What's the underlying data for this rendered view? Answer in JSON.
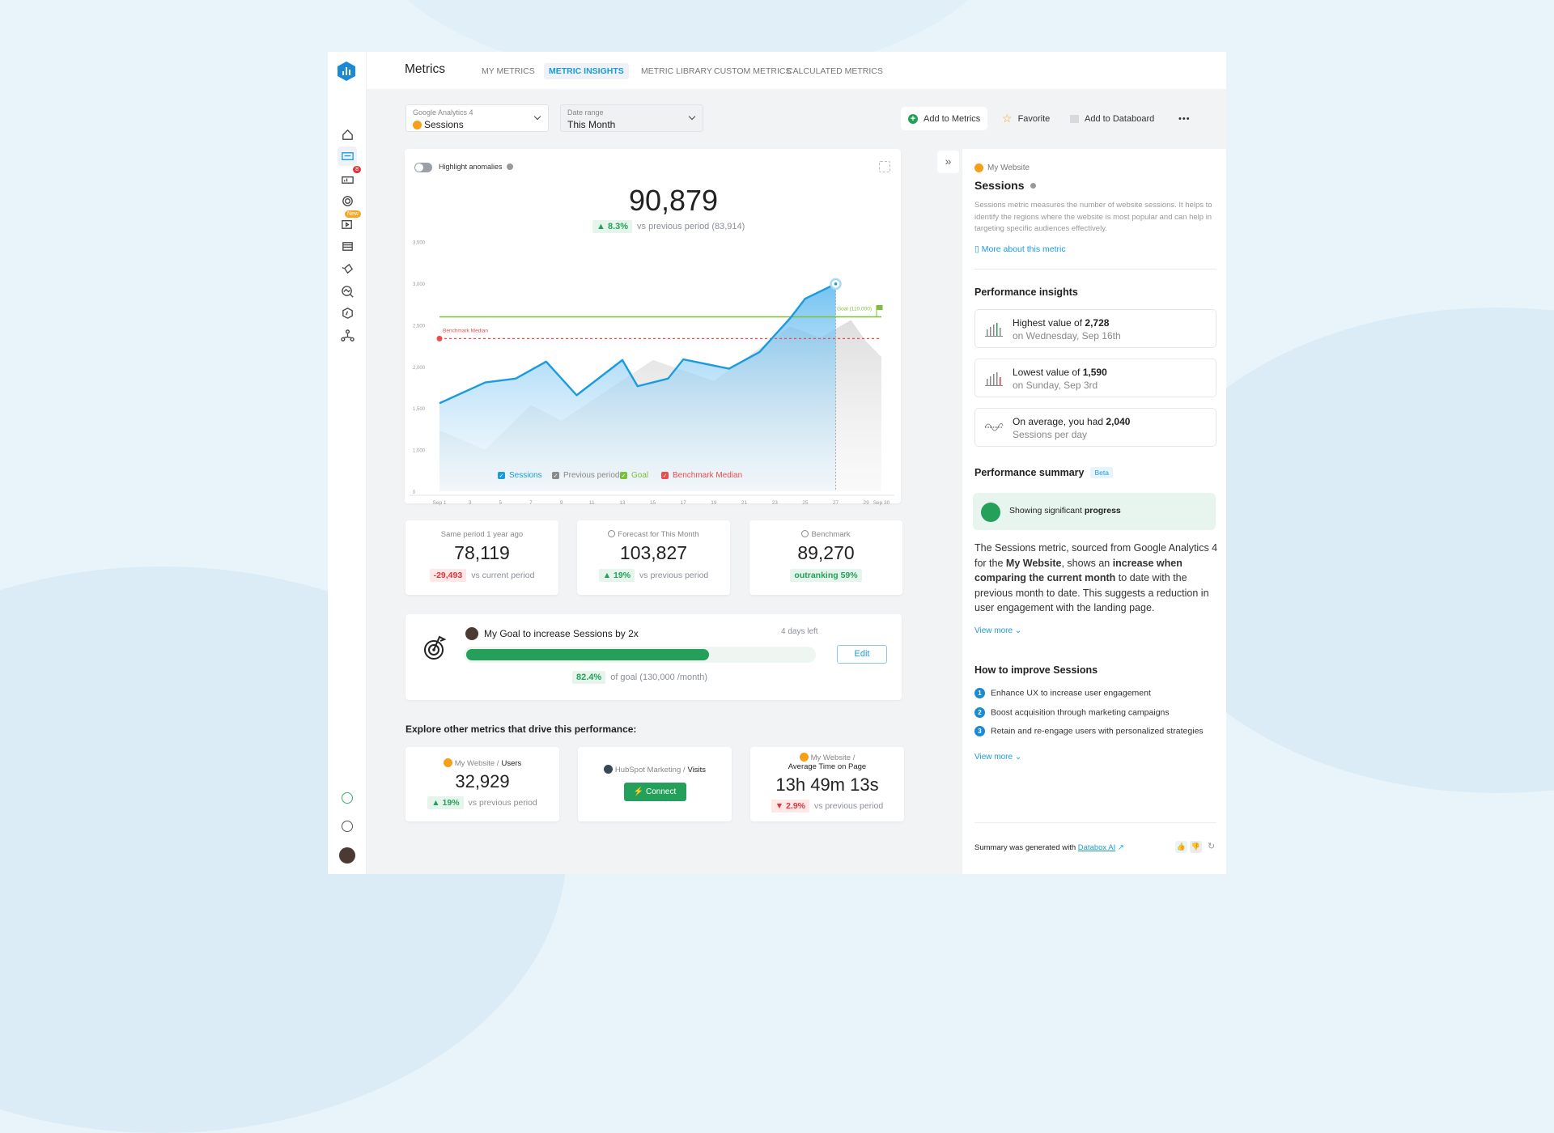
{
  "app": {
    "title": "Metrics"
  },
  "tabs": [
    {
      "label": "MY METRICS"
    },
    {
      "label": "METRIC INSIGHTS",
      "active": true
    },
    {
      "label": "METRIC LIBRARY"
    },
    {
      "label": "CUSTOM METRICS"
    },
    {
      "label": "CALCULATED METRICS"
    }
  ],
  "sidebar": {
    "items": [
      {
        "icon": "home-icon"
      },
      {
        "icon": "metrics-icon",
        "active": true
      },
      {
        "icon": "databoards-icon",
        "badge": "8"
      },
      {
        "icon": "goals-icon"
      },
      {
        "icon": "video-icon",
        "badge": "New"
      },
      {
        "icon": "data-stack-icon"
      },
      {
        "icon": "alerts-icon"
      },
      {
        "icon": "analytics-icon"
      },
      {
        "icon": "benchmark-icon"
      },
      {
        "icon": "team-icon"
      }
    ],
    "bottom": [
      {
        "icon": "award-icon"
      },
      {
        "icon": "help-icon"
      },
      {
        "icon": "avatar"
      }
    ]
  },
  "filters": {
    "source_label": "Google Analytics 4",
    "source_value": "Sessions",
    "date_label": "Date range",
    "date_value": "This Month"
  },
  "actions": {
    "add_metrics": "Add to Metrics",
    "favorite": "Favorite",
    "add_databoard": "Add to Databoard",
    "more": "•••"
  },
  "chart": {
    "toggle_label": "Highlight anomalies",
    "toggle_on": false,
    "total": "90,879",
    "change": "8.3%",
    "change_text": "vs previous period (83,914)",
    "goal_label": "Goal (110,000)",
    "benchmark_label": "Benchmark Median"
  },
  "chart_data": {
    "type": "area",
    "y_ticks": [
      "0",
      "1,000",
      "1,500",
      "2,000",
      "2,500",
      "3,000",
      "3,500"
    ],
    "y_tick_values": [
      0,
      1000,
      1500,
      2000,
      2500,
      3000,
      3500
    ],
    "x_ticks": [
      {
        "day": 1,
        "label": "Sep 1"
      },
      {
        "day": 3,
        "label": "3"
      },
      {
        "day": 5,
        "label": "5"
      },
      {
        "day": 7,
        "label": "7"
      },
      {
        "day": 9,
        "label": "9"
      },
      {
        "day": 11,
        "label": "11"
      },
      {
        "day": 13,
        "label": "13"
      },
      {
        "day": 15,
        "label": "15"
      },
      {
        "day": 17,
        "label": "17"
      },
      {
        "day": 19,
        "label": "19"
      },
      {
        "day": 21,
        "label": "21"
      },
      {
        "day": 23,
        "label": "23"
      },
      {
        "day": 25,
        "label": "25"
      },
      {
        "day": 27,
        "label": "27"
      },
      {
        "day": 29,
        "label": "29"
      },
      {
        "day": 30,
        "label": "Sep 30"
      }
    ],
    "series": [
      {
        "name": "Sessions",
        "color": "#1a9be0",
        "points": [
          [
            1,
            1558
          ],
          [
            4,
            1808
          ],
          [
            6,
            1854
          ],
          [
            8,
            2058
          ],
          [
            10,
            1654
          ],
          [
            13,
            2077
          ],
          [
            14,
            1762
          ],
          [
            16,
            1854
          ],
          [
            17,
            2085
          ],
          [
            20,
            1973
          ],
          [
            22,
            2173
          ],
          [
            24,
            2577
          ],
          [
            25,
            2815
          ],
          [
            27,
            2992
          ]
        ]
      },
      {
        "name": "Previous period",
        "color": "#9a9a9a",
        "points": [
          [
            1,
            1231
          ],
          [
            4,
            1000
          ],
          [
            7,
            1538
          ],
          [
            9,
            1346
          ],
          [
            15,
            2077
          ],
          [
            19,
            1827
          ],
          [
            24,
            2481
          ],
          [
            26,
            2346
          ],
          [
            28,
            2558
          ],
          [
            29,
            2300
          ],
          [
            30,
            2115
          ]
        ]
      }
    ],
    "goal": {
      "name": "Goal",
      "value": 2596,
      "color": "#7cbf3a"
    },
    "benchmark": {
      "name": "Benchmark Median",
      "value": 2335,
      "color": "#ef4b4b"
    },
    "today_day": 27,
    "legend": [
      "Sessions",
      "Previous period",
      "Goal",
      "Benchmark Median"
    ],
    "legend_position": "bottom"
  },
  "stats": [
    {
      "title": "Same period 1 year ago",
      "value": "78,119",
      "delta": "-29,493",
      "delta_text": "vs current period"
    },
    {
      "title": "Forecast for This Month",
      "value": "103,827",
      "delta": "19%",
      "delta_text": "vs previous period"
    },
    {
      "title": "Benchmark",
      "value": "89,270",
      "delta": "outranking 59%"
    }
  ],
  "goal": {
    "title": "My Goal to increase Sessions by 2x",
    "days_left": "4 days left",
    "edit": "Edit",
    "percent": "82.4%",
    "progress": 82.4,
    "percent_text": "of goal (130,000 /month)"
  },
  "explore": {
    "heading": "Explore other metrics that drive this performance:",
    "cards": [
      {
        "source": "My Website /",
        "metric": "Users",
        "value": "32,929",
        "delta": "19%",
        "delta_text": "vs previous period"
      },
      {
        "source": "HubSpot Marketing /",
        "metric": "Visits",
        "button": "Connect"
      },
      {
        "source": "My Website /",
        "metric": "Average Time on Page",
        "value": "13h 49m 13s",
        "delta": "2.9%",
        "delta_text": "vs previous period"
      }
    ]
  },
  "panel": {
    "source": "My Website",
    "title": "Sessions",
    "description": "Sessions metric measures the number of website sessions. It helps to identify the regions where the website is most popular and can help in targeting specific audiences effectively.",
    "more_link": "More about this metric",
    "insights_heading": "Performance insights",
    "insights": [
      {
        "t1": "Highest value of ",
        "b": "2,728",
        "t2": "on Wednesday, Sep 16th"
      },
      {
        "t1": "Lowest value of ",
        "b": "1,590",
        "t2": "on Sunday, Sep 3rd"
      },
      {
        "t1": "On average, you had ",
        "b": "2,040",
        "t2": "Sessions per day"
      }
    ],
    "summary_heading": "Performance summary",
    "beta": "Beta",
    "status_pre": "Showing significant ",
    "status_bold": "progress",
    "summary": {
      "p1": "The Sessions metric, sourced from Google Analytics 4 for the ",
      "b1": "My Website",
      "p2": ", shows an ",
      "b2": "increase when comparing the current month",
      "p3": " to date with the previous month to date. This suggests a reduction in user engagement with the landing page."
    },
    "view_more": "View more",
    "improve_heading": "How to improve Sessions",
    "improve": [
      "Enhance UX to increase user engagement",
      "Boost acquisition through marketing campaigns",
      "Retain and re-engage users with personalized strategies"
    ],
    "footer_text": "Summary was generated with ",
    "footer_link": "Databox AI"
  }
}
